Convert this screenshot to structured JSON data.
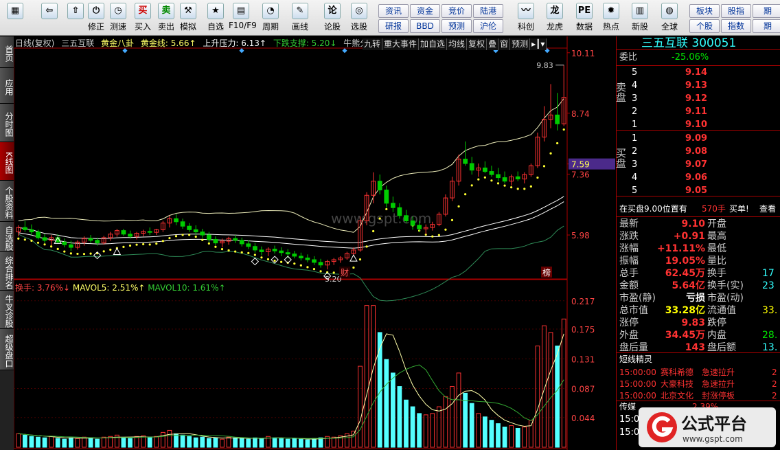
{
  "toolbar": {
    "buttons": [
      {
        "label": "",
        "icon": "menu-grid-icon",
        "glyph": "▦"
      },
      {
        "label": "",
        "icon": "back-arrow-icon",
        "glyph": "⇦"
      },
      {
        "label": "",
        "icon": "up-arrow-icon",
        "glyph": "⇧"
      },
      {
        "label": "修正",
        "icon": "adjust-icon",
        "glyph": "⏻"
      },
      {
        "label": "测速",
        "icon": "clock-icon",
        "glyph": "◷"
      },
      {
        "label": "买入",
        "icon": "buy-icon",
        "glyph": "买"
      },
      {
        "label": "卖出",
        "icon": "sell-icon",
        "glyph": "卖"
      },
      {
        "label": "模拟",
        "icon": "hammer-icon",
        "glyph": "⚒"
      },
      {
        "label": "自选",
        "icon": "star-icon",
        "glyph": "★"
      },
      {
        "label": "F10/F9",
        "icon": "f10-icon",
        "glyph": "▤"
      },
      {
        "label": "周期",
        "icon": "period-icon",
        "glyph": "◔"
      },
      {
        "label": "画线",
        "icon": "pencil-icon",
        "glyph": "✎"
      },
      {
        "label": "论股",
        "icon": "discuss-icon",
        "glyph": "论"
      },
      {
        "label": "选股",
        "icon": "select-stock-icon",
        "glyph": "◎"
      },
      {
        "label": "科创",
        "icon": "chart-icon",
        "glyph": "〰"
      },
      {
        "label": "龙虎",
        "icon": "dragon-icon",
        "glyph": "龙"
      },
      {
        "label": "数据",
        "icon": "pe-icon",
        "glyph": "PE"
      },
      {
        "label": "热点",
        "icon": "hot-icon",
        "glyph": "✹"
      },
      {
        "label": "新股",
        "icon": "new-stock-icon",
        "glyph": "▥"
      },
      {
        "label": "全球",
        "icon": "globe-icon",
        "glyph": "◍"
      }
    ],
    "small_buttons": [
      [
        "资讯",
        "资金",
        "竞价",
        "陆港"
      ],
      [
        "研报",
        "BBD",
        "预测",
        "沪伦"
      ],
      [
        "板块",
        "股指",
        "期"
      ],
      [
        "个股",
        "指数",
        "期"
      ]
    ]
  },
  "left_tabs": [
    "首页",
    "应用",
    "分时图",
    "K线图",
    "个股资料",
    "自选股",
    "综合排名",
    "牛叉诊股",
    "超级盘口"
  ],
  "infobar": {
    "period": "日线(复权)",
    "name": "三五互联",
    "gold_bagua": "黄金八卦",
    "gold_line": "黄金线: 5.66↑",
    "resistance": "上升压力: 6.13↑",
    "support": "下跌支撑: 5.20↓",
    "bull_bear": "牛熊分界线"
  },
  "kline_buttons": [
    "九转",
    "重大事件",
    "加自选",
    "均线",
    "复权",
    "叠",
    "窗",
    "预测"
  ],
  "volume_info": {
    "turnover": "换手: 3.76%↓",
    "mavol5": "MAVOL5: 2.51%↑",
    "mavol10": "MAVOL10: 1.61%↑"
  },
  "chart_data": {
    "type": "candlestick",
    "price_axis_labels": [
      "10.11",
      "8.74",
      "7.59",
      "7.36",
      "5.98"
    ],
    "price_current_label": "7.59",
    "volume_axis_labels": [
      "0.217",
      "0.175",
      "0.131",
      "0.087",
      "0.044"
    ],
    "annotations": {
      "high": "9.83",
      "low": "5.20",
      "fin_marker": "财",
      "list_marker": "榜"
    },
    "watermark": "www.gspt.com",
    "ylim": [
      5.0,
      10.2
    ],
    "candles": [
      [
        6.05,
        6.2,
        5.95,
        6.15
      ],
      [
        6.15,
        6.3,
        6.05,
        6.1
      ],
      [
        6.1,
        6.22,
        5.98,
        6.05
      ],
      [
        6.05,
        6.1,
        5.88,
        5.92
      ],
      [
        5.92,
        6.0,
        5.8,
        5.86
      ],
      [
        5.86,
        5.98,
        5.75,
        5.92
      ],
      [
        5.92,
        6.0,
        5.78,
        5.82
      ],
      [
        5.82,
        5.9,
        5.7,
        5.76
      ],
      [
        5.76,
        5.85,
        5.62,
        5.7
      ],
      [
        5.7,
        5.86,
        5.65,
        5.82
      ],
      [
        5.82,
        5.95,
        5.74,
        5.9
      ],
      [
        5.9,
        5.98,
        5.8,
        5.86
      ],
      [
        5.86,
        5.92,
        5.74,
        5.8
      ],
      [
        5.8,
        5.96,
        5.76,
        5.92
      ],
      [
        5.92,
        6.05,
        5.85,
        6.0
      ],
      [
        6.0,
        6.12,
        5.94,
        6.08
      ],
      [
        6.08,
        6.12,
        5.96,
        6.0
      ],
      [
        6.0,
        6.08,
        5.9,
        5.95
      ],
      [
        5.95,
        6.05,
        5.88,
        6.02
      ],
      [
        6.02,
        6.1,
        5.95,
        6.06
      ],
      [
        6.06,
        6.15,
        5.98,
        6.04
      ],
      [
        6.04,
        6.12,
        5.98,
        6.1
      ],
      [
        6.1,
        6.3,
        6.05,
        6.25
      ],
      [
        6.25,
        6.42,
        6.15,
        6.35
      ],
      [
        6.35,
        6.45,
        6.2,
        6.28
      ],
      [
        6.28,
        6.35,
        6.12,
        6.18
      ],
      [
        6.18,
        6.25,
        6.05,
        6.1
      ],
      [
        6.1,
        6.2,
        5.98,
        6.05
      ],
      [
        6.05,
        6.12,
        5.92,
        5.98
      ],
      [
        5.98,
        6.05,
        5.82,
        5.88
      ],
      [
        5.88,
        5.95,
        5.75,
        5.8
      ],
      [
        5.8,
        5.9,
        5.7,
        5.84
      ],
      [
        5.84,
        5.94,
        5.76,
        5.9
      ],
      [
        5.9,
        5.98,
        5.8,
        5.86
      ],
      [
        5.86,
        5.92,
        5.72,
        5.78
      ],
      [
        5.78,
        5.86,
        5.66,
        5.72
      ],
      [
        5.72,
        5.8,
        5.58,
        5.64
      ],
      [
        5.64,
        5.72,
        5.52,
        5.6
      ],
      [
        5.6,
        5.7,
        5.5,
        5.66
      ],
      [
        5.66,
        5.74,
        5.56,
        5.62
      ],
      [
        5.62,
        5.7,
        5.5,
        5.58
      ],
      [
        5.58,
        5.66,
        5.46,
        5.55
      ],
      [
        5.55,
        5.62,
        5.45,
        5.5
      ],
      [
        5.5,
        5.58,
        5.4,
        5.46
      ],
      [
        5.46,
        5.54,
        5.36,
        5.42
      ],
      [
        5.42,
        5.5,
        5.3,
        5.36
      ],
      [
        5.36,
        5.44,
        5.24,
        5.3
      ],
      [
        5.3,
        5.42,
        5.2,
        5.38
      ],
      [
        5.38,
        5.46,
        5.3,
        5.42
      ],
      [
        5.42,
        5.5,
        5.35,
        5.46
      ],
      [
        5.46,
        5.6,
        5.42,
        5.56
      ],
      [
        5.56,
        5.7,
        5.5,
        5.64
      ],
      [
        5.64,
        6.4,
        5.6,
        6.3
      ],
      [
        6.3,
        6.95,
        6.2,
        6.88
      ],
      [
        6.88,
        7.4,
        6.7,
        7.2
      ],
      [
        7.2,
        7.35,
        6.9,
        7.0
      ],
      [
        7.0,
        7.1,
        6.6,
        6.7
      ],
      [
        6.7,
        6.85,
        6.5,
        6.6
      ],
      [
        6.6,
        6.7,
        6.35,
        6.42
      ],
      [
        6.42,
        6.55,
        6.25,
        6.3
      ],
      [
        6.3,
        6.4,
        6.1,
        6.2
      ],
      [
        6.2,
        6.3,
        6.05,
        6.12
      ],
      [
        6.12,
        6.22,
        6.0,
        6.15
      ],
      [
        6.15,
        6.28,
        6.08,
        6.22
      ],
      [
        6.22,
        6.5,
        6.18,
        6.45
      ],
      [
        6.45,
        6.9,
        6.4,
        6.82
      ],
      [
        6.82,
        7.3,
        6.75,
        7.2
      ],
      [
        7.2,
        7.8,
        7.1,
        7.7
      ],
      [
        7.7,
        8.1,
        7.55,
        7.6
      ],
      [
        7.6,
        7.75,
        7.35,
        7.45
      ],
      [
        7.45,
        7.6,
        7.3,
        7.5
      ],
      [
        7.5,
        7.65,
        7.38,
        7.42
      ],
      [
        7.42,
        7.55,
        7.3,
        7.35
      ],
      [
        7.35,
        7.5,
        7.2,
        7.28
      ],
      [
        7.28,
        7.42,
        7.15,
        7.2
      ],
      [
        7.2,
        7.35,
        7.1,
        7.3
      ],
      [
        7.3,
        7.42,
        7.2,
        7.25
      ],
      [
        7.25,
        7.4,
        7.15,
        7.35
      ],
      [
        7.35,
        7.6,
        7.3,
        7.55
      ],
      [
        7.55,
        8.3,
        7.5,
        8.2
      ],
      [
        8.2,
        8.9,
        8.1,
        8.6
      ],
      [
        8.6,
        9.4,
        8.4,
        8.7
      ],
      [
        8.7,
        9.2,
        8.35,
        8.5
      ],
      [
        8.5,
        9.83,
        8.45,
        9.1
      ]
    ],
    "volumes": [
      0.02,
      0.018,
      0.016,
      0.015,
      0.014,
      0.016,
      0.013,
      0.012,
      0.014,
      0.013,
      0.015,
      0.014,
      0.012,
      0.015,
      0.016,
      0.018,
      0.014,
      0.013,
      0.016,
      0.017,
      0.015,
      0.016,
      0.022,
      0.025,
      0.02,
      0.018,
      0.016,
      0.014,
      0.015,
      0.013,
      0.014,
      0.012,
      0.015,
      0.014,
      0.013,
      0.012,
      0.014,
      0.013,
      0.016,
      0.014,
      0.013,
      0.012,
      0.013,
      0.012,
      0.011,
      0.013,
      0.014,
      0.016,
      0.015,
      0.017,
      0.02,
      0.024,
      0.12,
      0.21,
      0.21,
      0.17,
      0.13,
      0.11,
      0.09,
      0.07,
      0.06,
      0.05,
      0.048,
      0.05,
      0.06,
      0.075,
      0.09,
      0.11,
      0.08,
      0.065,
      0.05,
      0.045,
      0.04,
      0.035,
      0.03,
      0.032,
      0.028,
      0.03,
      0.04,
      0.15,
      0.18,
      0.17,
      0.15,
      0.19
    ]
  },
  "right_panel": {
    "title": "三五互联 300051",
    "weibi_label": "委比",
    "weibi_value": "-25.06%",
    "sell_label": "卖盘",
    "buy_label": "买盘",
    "sell": [
      {
        "lvl": "5",
        "price": "9.14"
      },
      {
        "lvl": "4",
        "price": "9.13"
      },
      {
        "lvl": "3",
        "price": "9.12"
      },
      {
        "lvl": "2",
        "price": "9.11"
      },
      {
        "lvl": "1",
        "price": "9.10"
      }
    ],
    "buy": [
      {
        "lvl": "1",
        "price": "9.09"
      },
      {
        "lvl": "2",
        "price": "9.08"
      },
      {
        "lvl": "3",
        "price": "9.07"
      },
      {
        "lvl": "4",
        "price": "9.06"
      },
      {
        "lvl": "5",
        "price": "9.05"
      }
    ],
    "notice": {
      "text": "在买盘9.00位置有",
      "qty": "570手",
      "tag": "买单!",
      "link": "查看"
    },
    "quote": [
      {
        "l": "最新",
        "v": "9.10",
        "l2": "开盘",
        "v2": ""
      },
      {
        "l": "涨跌",
        "v": "+0.91",
        "l2": "最高",
        "v2": ""
      },
      {
        "l": "涨幅",
        "v": "+11.11%",
        "l2": "最低",
        "v2": ""
      },
      {
        "l": "振幅",
        "v": "19.05%",
        "l2": "量比",
        "v2": ""
      },
      {
        "l": "总手",
        "v": "62.45万",
        "l2": "换手",
        "v2": "17"
      },
      {
        "l": "金额",
        "v": "5.64亿",
        "l2": "换手(实)",
        "v2": "23"
      },
      {
        "l": "市盈(静)",
        "v": "亏损",
        "l2": "市盈(动)",
        "v2": ""
      },
      {
        "l": "总市值",
        "v": "33.28亿",
        "l2": "流通值",
        "v2": "33."
      },
      {
        "l": "涨停",
        "v": "9.83",
        "l2": "跌停",
        "v2": ""
      },
      {
        "l": "外盘",
        "v": "34.45万",
        "l2": "内盘",
        "v2": "28."
      },
      {
        "l": "盘后量",
        "v": "143",
        "l2": "盘后额",
        "v2": "13."
      }
    ],
    "short_title": "短线精灵",
    "short_items": [
      {
        "time": "15:00:00",
        "name": "赛科希德",
        "event": "急速拉升",
        "n": "2"
      },
      {
        "time": "15:00:00",
        "name": "大豪科技",
        "event": "急速拉升",
        "n": "2"
      },
      {
        "time": "15:00:00",
        "name": "北京文化",
        "event": "封涨停板",
        "n": "2"
      }
    ],
    "bottom": {
      "label": "传媒",
      "pct": "2.39%",
      "t1": "15:0",
      "t2": "15:0"
    }
  },
  "logo": {
    "text": "公式平台",
    "url_text": "www.gspt.com"
  }
}
